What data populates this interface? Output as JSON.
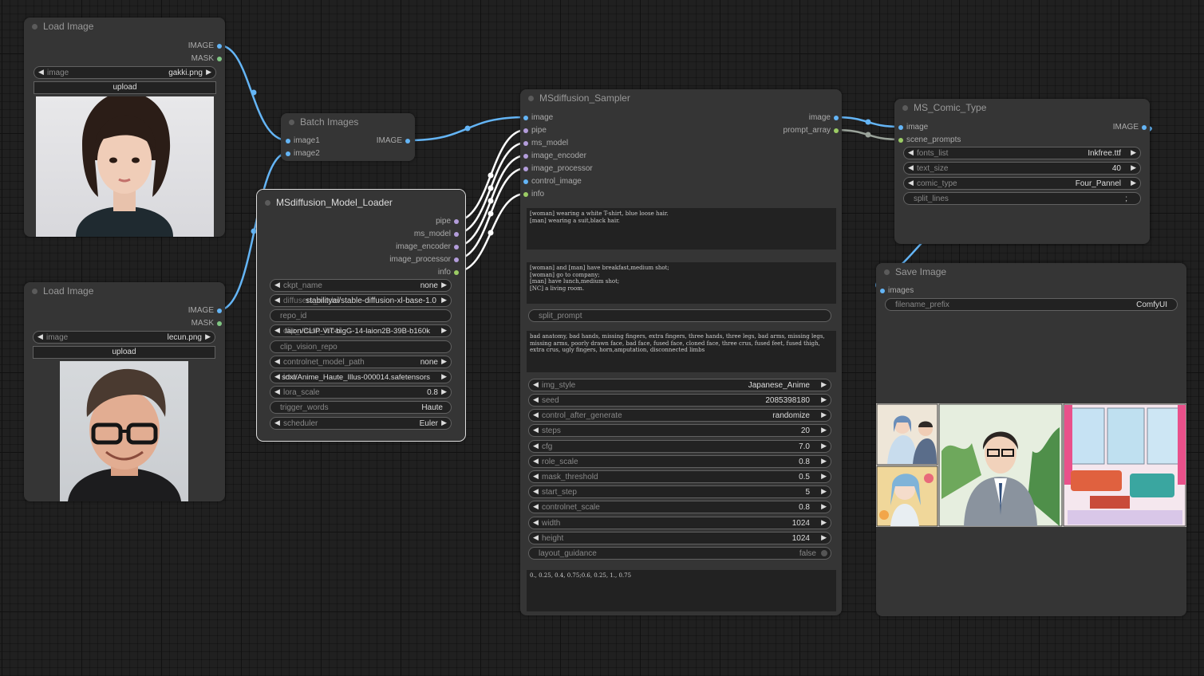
{
  "load_image_1": {
    "title": "Load Image",
    "outputs": [
      "IMAGE",
      "MASK"
    ],
    "image_widget": {
      "label": "image",
      "value": "gakki.png"
    },
    "upload_label": "upload"
  },
  "load_image_2": {
    "title": "Load Image",
    "outputs": [
      "IMAGE",
      "MASK"
    ],
    "image_widget": {
      "label": "image",
      "value": "lecun.png"
    },
    "upload_label": "upload"
  },
  "batch_images": {
    "title": "Batch Images",
    "inputs": [
      "image1",
      "image2"
    ],
    "output": "IMAGE"
  },
  "model_loader": {
    "title": "MSdiffusion_Model_Loader",
    "outputs": [
      "pipe",
      "ms_model",
      "image_encoder",
      "image_processor",
      "info"
    ],
    "widgets": [
      {
        "label": "ckpt_name",
        "value": "none",
        "arrows": true
      },
      {
        "label": "diffusers_model",
        "value": "stabilityai/stable-diffusion-xl-base-1.0",
        "arrows": true
      },
      {
        "label": "repo_id",
        "value": "",
        "arrows": false
      },
      {
        "label": "clip_vision_local",
        "value": "laion/CLIP-ViT-bigG-14-laion2B-39B-b160k",
        "arrows": true
      },
      {
        "label": "clip_vision_repo",
        "value": "",
        "arrows": false
      },
      {
        "label": "controlnet_model_path",
        "value": "none",
        "arrows": true
      },
      {
        "label": "lora",
        "value": "sdxl/Anime_Haute_Illus-000014.safetensors",
        "arrows": true
      },
      {
        "label": "lora_scale",
        "value": "0.8",
        "arrows": true
      },
      {
        "label": "trigger_words",
        "value": "Haute",
        "arrows": false
      },
      {
        "label": "scheduler",
        "value": "Euler",
        "arrows": true
      }
    ]
  },
  "sampler": {
    "title": "MSdiffusion_Sampler",
    "inputs": [
      "image",
      "pipe",
      "ms_model",
      "image_encoder",
      "image_processor",
      "control_image",
      "info"
    ],
    "outputs": [
      "image",
      "prompt_array"
    ],
    "character_prompt": "[woman] wearing a white T-shirt, blue loose hair.\n[man] wearing a suit,black hair.",
    "scene_prompts": "[woman] and [man] have breakfast,medium shot;\n[woman] go to company;\n[man] have lunch,medium shot;\n[NC] a living room.",
    "split_prompt": {
      "label": "split_prompt",
      "value": ""
    },
    "negative_prompt": "bad anatomy, bad hands, missing fingers, extra fingers, three hands, three legs, bad arms, missing legs, missing arms, poorly drawn face, bad face, fused face, cloned face, three crus, fused feet, fused thigh, extra crus, ugly fingers, horn,amputation, disconnected limbs",
    "widgets": [
      {
        "label": "img_style",
        "value": "Japanese_Anime"
      },
      {
        "label": "seed",
        "value": "2085398180"
      },
      {
        "label": "control_after_generate",
        "value": "randomize"
      },
      {
        "label": "steps",
        "value": "20"
      },
      {
        "label": "cfg",
        "value": "7.0"
      },
      {
        "label": "role_scale",
        "value": "0.8"
      },
      {
        "label": "mask_threshold",
        "value": "0.5"
      },
      {
        "label": "start_step",
        "value": "5"
      },
      {
        "label": "controlnet_scale",
        "value": "0.8"
      },
      {
        "label": "width",
        "value": "1024"
      },
      {
        "label": "height",
        "value": "1024"
      }
    ],
    "layout_guidance": {
      "label": "layout_guidance",
      "value": "false"
    },
    "guidance_list": "0., 0.25, 0.4, 0.75;0.6, 0.25, 1., 0.75"
  },
  "comic_type": {
    "title": "MS_Comic_Type",
    "inputs": [
      "image",
      "scene_prompts"
    ],
    "output": "IMAGE",
    "widgets": [
      {
        "label": "fonts_list",
        "value": "Inkfree.ttf",
        "arrows": true
      },
      {
        "label": "text_size",
        "value": "40",
        "arrows": true
      },
      {
        "label": "comic_type",
        "value": "Four_Pannel",
        "arrows": true
      },
      {
        "label": "split_lines",
        "value": ";",
        "arrows": false
      }
    ]
  },
  "save_image": {
    "title": "Save Image",
    "input": "images",
    "widget": {
      "label": "filename_prefix",
      "value": "ComfyUI"
    }
  },
  "colors": {
    "canvas": "#202020",
    "node": "#353535",
    "image_link": "#64b5f6",
    "mask_slot": "#81c784",
    "pipe_slot": "#b39ddb",
    "info_slot": "#9ccc65",
    "model_link": "#ffffff"
  }
}
